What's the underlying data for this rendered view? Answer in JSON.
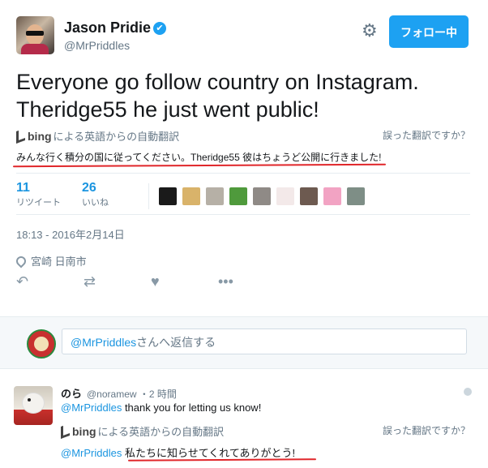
{
  "author": {
    "name": "Jason Pridie",
    "handle": "@MrPriddles",
    "verified_glyph": "✔"
  },
  "header": {
    "settings_icon": "gear-icon",
    "follow_label": "フォロー中",
    "accent": "#1da1f2"
  },
  "tweet": {
    "text": "Everyone go follow country on Instagram. Theridge55 he just went public!",
    "translation_source": "bing",
    "translation_note": "による英語からの自動翻訳",
    "wrong_translation_link": "誤った翻訳ですか？",
    "translation": "みんな行く積分の国に従ってください。Theridge55 彼はちょうど公開に行きました!"
  },
  "stats": {
    "retweets_count": "11",
    "retweets_label": "リツイート",
    "likes_count": "26",
    "likes_label": "いいね"
  },
  "meta": {
    "timestamp": "18:13 - 2016年2月14日",
    "location": "宮崎 日南市"
  },
  "actions": [
    "reply-icon",
    "retweet-icon",
    "like-icon",
    "more-icon"
  ],
  "reply_box": {
    "mention": "@MrPriddles",
    "placeholder_suffix": "さんへ返信する"
  },
  "reply": {
    "name": "のら",
    "handle": "@noramew",
    "time": "・2 時間",
    "mention": "@MrPriddles",
    "text": " thank you for letting us know!",
    "translation_source": "bing",
    "translation_note": "による英語からの自動翻訳",
    "wrong_translation_link": "誤った翻訳ですか？",
    "translation": "私たちに知らせてくれてありがとう!"
  }
}
